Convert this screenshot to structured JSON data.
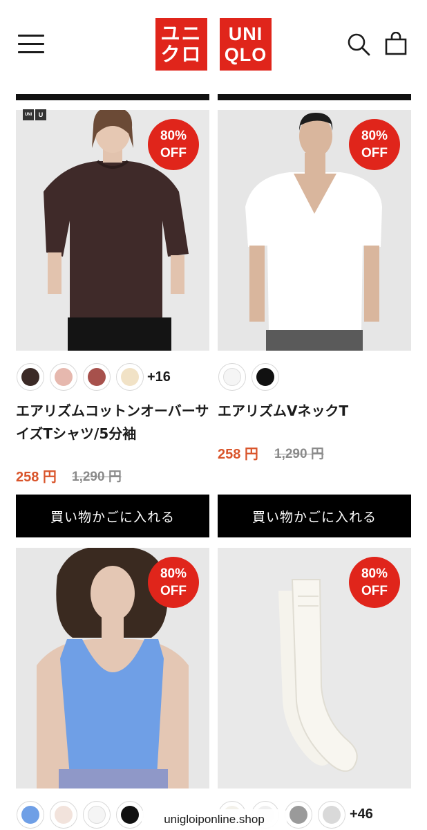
{
  "header": {
    "logo_jp_line1": "ユニ",
    "logo_jp_line2": "クロ",
    "logo_en_line1": "UNI",
    "logo_en_line2": "QLO",
    "brand_color": "#e0251b"
  },
  "products": [
    {
      "badge_line1": "80%",
      "badge_line2": "OFF",
      "tag_left": "UNI",
      "tag_right": "U",
      "swatch_colors": [
        "#3b2a26",
        "#e6b8ae",
        "#a7514c",
        "#f1e2c6"
      ],
      "more_colors": "+16",
      "name": "エアリズムコットンオーバーサイズTシャツ/5分袖",
      "price": "258 円",
      "old_price": "1,290 円",
      "cart_label": "買い物かごに入れる"
    },
    {
      "badge_line1": "80%",
      "badge_line2": "OFF",
      "swatch_colors": [
        "#f5f5f5",
        "#111111"
      ],
      "name": "エアリズムVネックT",
      "price": "258 円",
      "old_price": "1,290 円",
      "cart_label": "買い物かごに入れる"
    },
    {
      "badge_line1": "80%",
      "badge_line2": "OFF",
      "swatch_colors": [
        "#6f9fe6",
        "#f2e3dc",
        "#f5f5f5",
        "#111111"
      ]
    },
    {
      "badge_line1": "80%",
      "badge_line2": "OFF",
      "swatch_colors": [
        "#f3f1ea",
        "#efefef",
        "#9a9a9a",
        "#d9d9d9"
      ],
      "more_colors": "+46"
    }
  ],
  "url": "unigloiponline.shop",
  "colors": {
    "sale_price": "#d9542a",
    "badge": "#e0251b",
    "button": "#000000"
  }
}
